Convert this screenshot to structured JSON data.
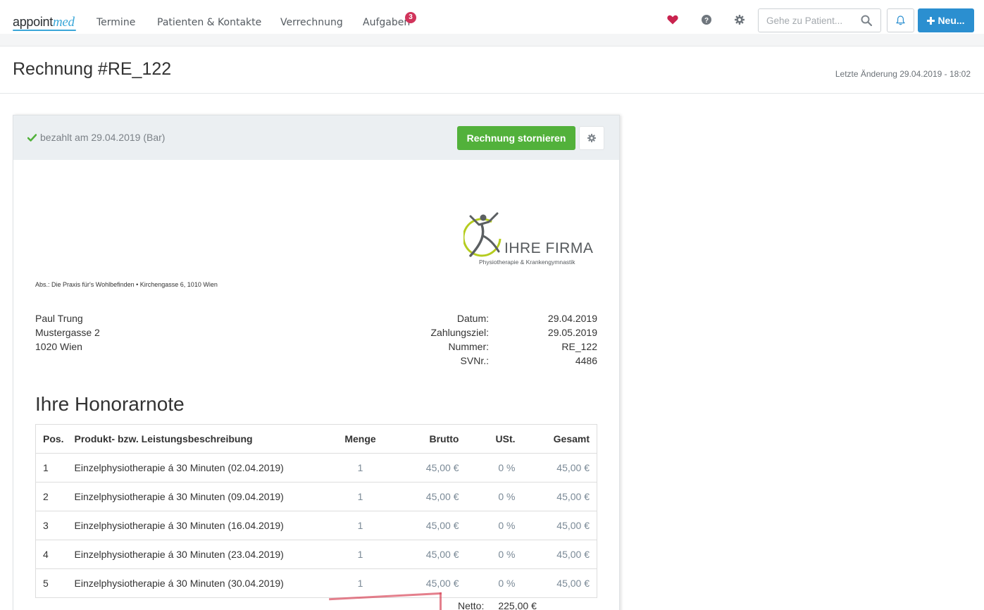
{
  "app": {
    "logo_main": "appoint",
    "logo_accent": "med"
  },
  "nav": {
    "items": [
      "Termine",
      "Patienten & Kontakte",
      "Verrechnung",
      "Aufgaben"
    ],
    "tasks_badge": "3",
    "search_placeholder": "Gehe zu Patient...",
    "new_label": "Neu...",
    "icons": [
      "heart-icon",
      "help-icon",
      "gear-icon",
      "search-icon",
      "bell-icon",
      "plus-icon"
    ],
    "colors": {
      "heart": "#c9234f",
      "primary": "#2b8fd0",
      "badge": "#d1345b"
    }
  },
  "page": {
    "title": "Rechnung #RE_122",
    "last_change": "Letzte Änderung 29.04.2019 - 18:02"
  },
  "card": {
    "status": "bezahlt am 29.04.2019 (Bar)",
    "storno_label": "Rechnung stornieren",
    "colors": {
      "success": "#52b13b"
    }
  },
  "invoice": {
    "company_name": "IHRE FIRMA",
    "company_subtitle": "Physiotherapie & Krankengymnastik",
    "sender_line": "Abs.: Die Praxis für's Wohlbefinden • Kirchengasse 6, 1010 Wien",
    "recipient": [
      "Paul Trung",
      "Mustergasse 2",
      "1020 Wien"
    ],
    "meta": [
      {
        "label": "Datum:",
        "value": "29.04.2019"
      },
      {
        "label": "Zahlungsziel:",
        "value": "29.05.2019"
      },
      {
        "label": "Nummer:",
        "value": "RE_122"
      },
      {
        "label": "SVNr.:",
        "value": "4486"
      }
    ],
    "heading": "Ihre Honorarnote",
    "columns": [
      "Pos.",
      "Produkt- bzw. Leistungsbeschreibung",
      "Menge",
      "Brutto",
      "USt.",
      "Gesamt"
    ],
    "rows": [
      [
        "1",
        "Einzelphysiotherapie á 30 Minuten (02.04.2019)",
        "1",
        "45,00 €",
        "0 %",
        "45,00 €"
      ],
      [
        "2",
        "Einzelphysiotherapie á 30 Minuten (09.04.2019)",
        "1",
        "45,00 €",
        "0 %",
        "45,00 €"
      ],
      [
        "3",
        "Einzelphysiotherapie á 30 Minuten (16.04.2019)",
        "1",
        "45,00 €",
        "0 %",
        "45,00 €"
      ],
      [
        "4",
        "Einzelphysiotherapie á 30 Minuten (23.04.2019)",
        "1",
        "45,00 €",
        "0 %",
        "45,00 €"
      ],
      [
        "5",
        "Einzelphysiotherapie á 30 Minuten (30.04.2019)",
        "1",
        "45,00 €",
        "0 %",
        "45,00 €"
      ]
    ],
    "netto_label": "Netto:",
    "netto_value": "225,00 €"
  }
}
